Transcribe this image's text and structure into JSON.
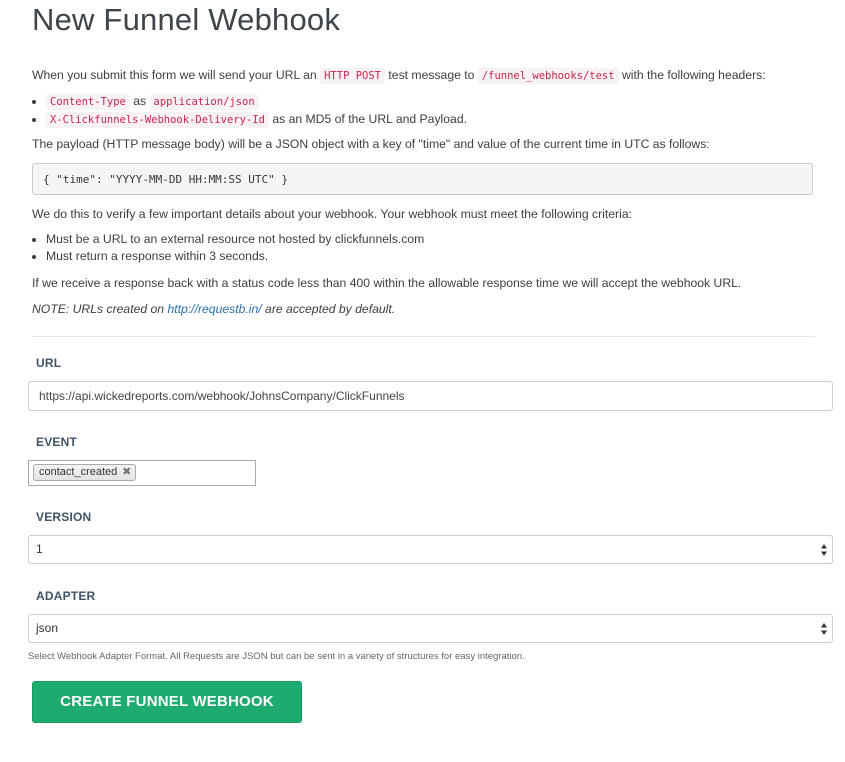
{
  "page": {
    "title": "New Funnel Webhook"
  },
  "intro": {
    "part1": "When you submit this form we will send your URL an ",
    "method": "HTTP POST",
    "part2": " test message to ",
    "endpoint": "/funnel_webhooks/test",
    "part3": " with the following headers:"
  },
  "headers": [
    {
      "name": "Content-Type",
      "sep": " as ",
      "value": "application/json"
    },
    {
      "name": "X-Clickfunnels-Webhook-Delivery-Id",
      "desc": " as an MD5 of the URL and Payload."
    }
  ],
  "payload_text": "The payload (HTTP message body) will be a JSON object with a key of \"time\" and value of the current time in UTC as follows:",
  "payload_example": "{ \"time\": \"YYYY-MM-DD HH:MM:SS UTC\" }",
  "verify_text": "We do this to verify a few important details about your webhook. Your webhook must meet the following criteria:",
  "criteria": [
    "Must be a URL to an external resource not hosted by clickfunnels.com",
    "Must return a response within 3 seconds."
  ],
  "accept_text": "If we receive a response back with a status code less than 400 within the allowable response time we will accept the webhook URL.",
  "note": {
    "prefix": "NOTE: URLs created on ",
    "link": "http://requestb.in/",
    "suffix": " are accepted by default."
  },
  "form": {
    "url": {
      "label": "URL",
      "value": "https://api.wickedreports.com/webhook/JohnsCompany/ClickFunnels"
    },
    "event": {
      "label": "EVENT",
      "selected": [
        "contact_created"
      ],
      "remove_glyph": "✖"
    },
    "version": {
      "label": "VERSION",
      "value": "1"
    },
    "adapter": {
      "label": "ADAPTER",
      "value": "json",
      "help": "Select Webhook Adapter Format. All Requests are JSON but can be sent in a variety of structures for easy integration."
    },
    "submit_label": "CREATE FUNNEL WEBHOOK"
  },
  "colors": {
    "button": "#1dab6f",
    "code_text": "#c7254e",
    "link": "#2a6fb0",
    "label": "#3f5468"
  }
}
